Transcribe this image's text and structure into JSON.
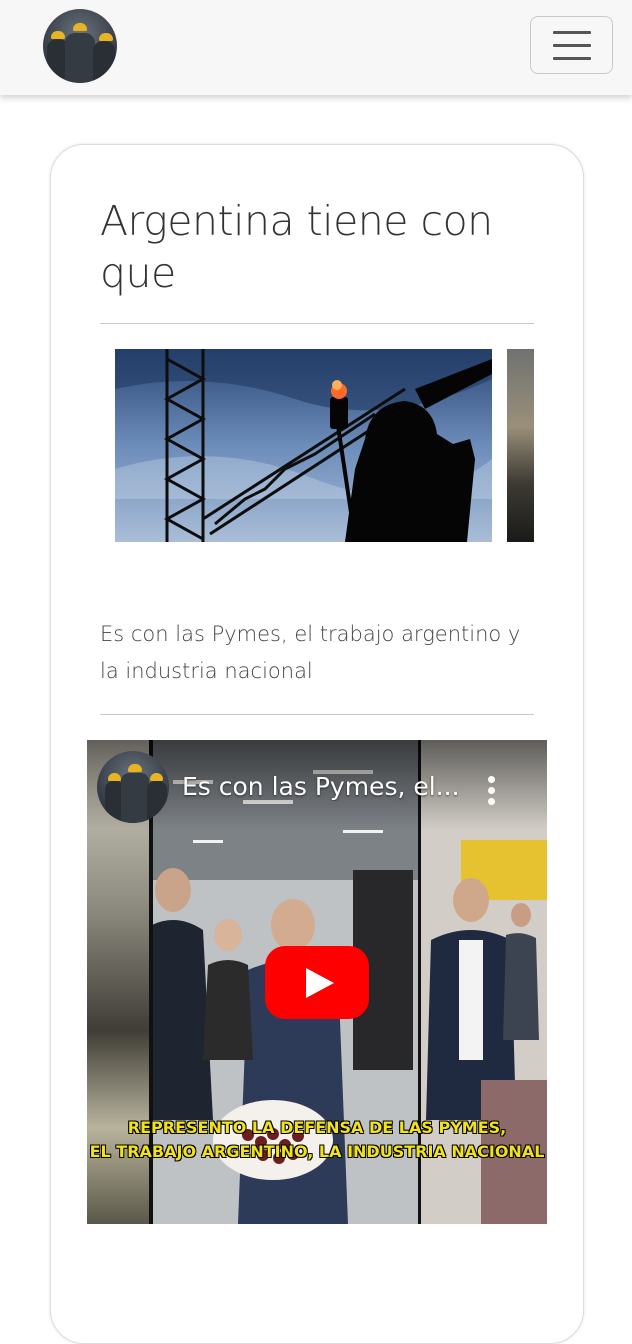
{
  "navbar": {
    "logo_icon": "workers-avatar-icon",
    "menu_icon": "hamburger-menu-icon"
  },
  "article": {
    "title": "Argentina tiene con que",
    "subtitle": "Es con las Pymes, el trabajo argentino y la industria nacional"
  },
  "video": {
    "title": "Es con las Pymes, el...",
    "caption_line1": "REPRESENTO LA DEFENSA DE LAS PYMES,",
    "caption_line2": "EL TRABAJO ARGENTINO, LA INDUSTRIA NACIONAL",
    "play_color": "#ff0000"
  }
}
